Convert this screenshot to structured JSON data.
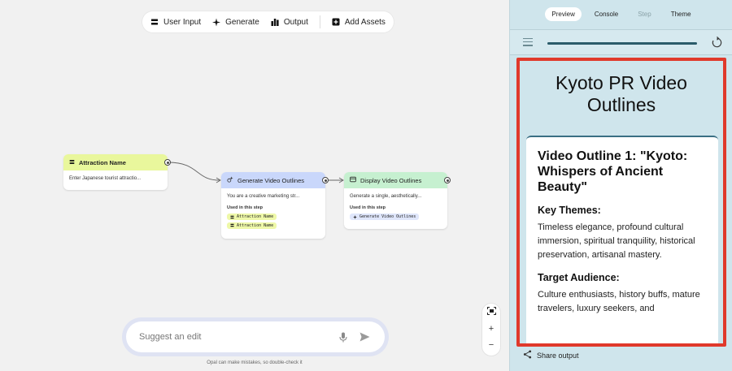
{
  "toolbar": {
    "items": [
      {
        "label": "User Input",
        "icon": "user-input-icon"
      },
      {
        "label": "Generate",
        "icon": "sparkle-icon"
      },
      {
        "label": "Output",
        "icon": "output-icon"
      },
      {
        "label": "Add Assets",
        "icon": "add-assets-icon"
      }
    ]
  },
  "nodes": {
    "attraction": {
      "title": "Attraction Name",
      "body": "Enter Japanese tourist attractio...",
      "color": "#e9f79c"
    },
    "generate": {
      "title": "Generate Video Outlines",
      "body": "You are a creative marketing str...",
      "used_label": "Used in this step",
      "chips": [
        "Attraction Name",
        "Attraction Name"
      ],
      "color": "#c9d7fb"
    },
    "display": {
      "title": "Display Video Outlines",
      "body": "Generate a single, aesthetically...",
      "used_label": "Used in this step",
      "chips": [
        "Generate Video Outlines"
      ],
      "color": "#c6f0d0"
    }
  },
  "suggest": {
    "placeholder": "Suggest an edit",
    "disclaimer": "Opal can make mistakes, so double-check it"
  },
  "zoom": {
    "fit_icon": "fit-screen-icon",
    "plus": "+",
    "minus": "−"
  },
  "panel": {
    "tabs": [
      {
        "label": "Preview",
        "state": "active"
      },
      {
        "label": "Console",
        "state": "normal"
      },
      {
        "label": "Step",
        "state": "disabled"
      },
      {
        "label": "Theme",
        "state": "normal"
      }
    ],
    "progress": 1.0,
    "preview": {
      "title": "Kyoto PR Video Outlines",
      "outline_heading": "Video Outline 1: \"Kyoto: Whispers of Ancient Beauty\"",
      "key_themes_label": "Key Themes:",
      "key_themes_text": "Timeless elegance, profound cultural immersion, spiritual tranquility, historical preservation, artisanal mastery.",
      "audience_label": "Target Audience:",
      "audience_text": "Culture enthusiasts, history buffs, mature travelers, luxury seekers, and"
    },
    "share_label": "Share output",
    "highlight_color": "#e0392b"
  }
}
